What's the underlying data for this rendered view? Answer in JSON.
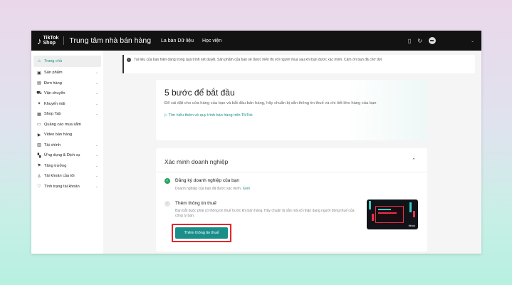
{
  "topbar": {
    "logo_line1": "TikTok",
    "logo_line2": "Shop",
    "app_title": "Trung tâm nhà bán hàng",
    "nav": [
      "La bàn Dữ liệu",
      "Học viện"
    ]
  },
  "sidebar": {
    "items": [
      {
        "label": "Trang chủ",
        "icon": "home-icon",
        "active": true,
        "chevron": false
      },
      {
        "label": "Sản phẩm",
        "icon": "product-icon",
        "chevron": true
      },
      {
        "label": "Đơn hàng",
        "icon": "order-icon",
        "chevron": true
      },
      {
        "label": "Vận chuyển",
        "icon": "truck-icon",
        "chevron": true
      },
      {
        "label": "Khuyến mãi",
        "icon": "promo-icon",
        "chevron": true
      },
      {
        "label": "Shop Tab",
        "icon": "shop-icon",
        "chevron": true
      },
      {
        "label": "Quảng cáo mua sắm",
        "icon": "ads-icon",
        "chevron": false
      },
      {
        "label": "Video bán hàng",
        "icon": "video-icon",
        "chevron": false
      },
      {
        "label": "Tài chính",
        "icon": "finance-icon",
        "chevron": true
      },
      {
        "label": "Ứng dụng & Dịch vụ",
        "icon": "apps-icon",
        "chevron": true
      },
      {
        "label": "Tăng trưởng",
        "icon": "growth-icon",
        "chevron": true
      },
      {
        "label": "Tài khoản của tôi",
        "icon": "account-icon",
        "chevron": true
      },
      {
        "label": "Tình trạng tài khoản",
        "icon": "status-icon",
        "chevron": true
      }
    ]
  },
  "notice": {
    "text": "Tài liệu của bạn hiện đang trong quá trình xét duyệt. Sản phẩm của bạn sẽ được hiển thị với người mua sau khi bạn được xác minh. Cảm ơn bạn đã chờ đợi"
  },
  "getting_started": {
    "title": "5 bước để bắt đầu",
    "description": "Để cài đặt cho cửa hàng của bạn và bắt đầu bán hàng, hãy chuẩn bị sẵn thông tin thuế và chi tiết kho hàng của bạn",
    "link": "Tìm hiểu thêm về quy trình bán hàng trên TikTok"
  },
  "verify_business": {
    "title": "Xác minh doanh nghiệp",
    "step1": {
      "title": "Đăng ký doanh nghiệp của bạn",
      "desc": "Doanh nghiệp của bạn đã được xác minh.",
      "link": "Xem"
    },
    "step2": {
      "title": "Thêm thông tin thuế",
      "desc": "Bạn bắt buộc phải có thông tin thuế trước khi bán hàng. Hãy chuẩn bị sẵn mã số nhận dạng người đóng thuế của công ty bạn.",
      "button": "Thêm thông tin thuế"
    },
    "thumb_label": "tiktok"
  },
  "colors": {
    "accent": "#1a8f8a",
    "highlight": "#e8242c",
    "success": "#26a65b"
  }
}
